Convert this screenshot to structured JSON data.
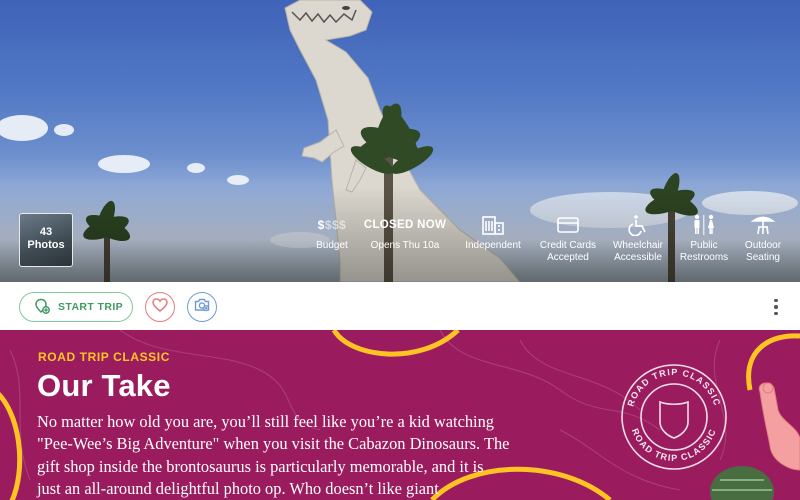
{
  "hero": {
    "photos": {
      "count": "43",
      "label": "Photos"
    },
    "amenities": [
      {
        "id": "budget",
        "icon": "budget-dollar-icon",
        "budget_on": "$",
        "budget_off": "$$$",
        "label": "Budget"
      },
      {
        "id": "hours",
        "title": "CLOSED NOW",
        "label": "Opens Thu 10a"
      },
      {
        "id": "independent",
        "icon": "building-icon",
        "label": "Independent"
      },
      {
        "id": "credit",
        "icon": "credit-card-icon",
        "label_line1": "Credit Cards",
        "label_line2": "Accepted"
      },
      {
        "id": "wheelchair",
        "icon": "wheelchair-icon",
        "label_line1": "Wheelchair",
        "label_line2": "Accessible"
      },
      {
        "id": "restrooms",
        "icon": "restroom-icon",
        "label_line1": "Public",
        "label_line2": "Restrooms"
      },
      {
        "id": "outdoor",
        "icon": "umbrella-table-icon",
        "label_line1": "Outdoor",
        "label_line2": "Seating"
      }
    ]
  },
  "actions": {
    "start_trip": "START TRIP",
    "favorite_icon": "heart-icon",
    "add_photo_icon": "add-photo-camera-icon",
    "more_icon": "more-vertical-icon"
  },
  "take": {
    "eyebrow": "ROAD TRIP CLASSIC",
    "title": "Our Take",
    "lines": [
      "No matter how old you are, you’ll still feel like you’re a kid watching",
      "\"Pee-Wee’s Big Adventure\" when you visit the Cabazon Dinosaurs. The",
      "gift shop inside the brontosaurus is particularly memorable, and it is",
      "just an all-around delightful photo op. Who doesn’t like giant"
    ],
    "badge_text_top": "ROAD TRIP CLASSIC",
    "badge_text_bottom": "ROAD TRIP CLASSIC"
  },
  "colors": {
    "take_background": "#9b1c5e",
    "eyebrow": "#ffc423",
    "start_trip_green": "#3f9a63",
    "favorite_red": "#e57b7b",
    "photo_blue": "#6f9bd6"
  }
}
